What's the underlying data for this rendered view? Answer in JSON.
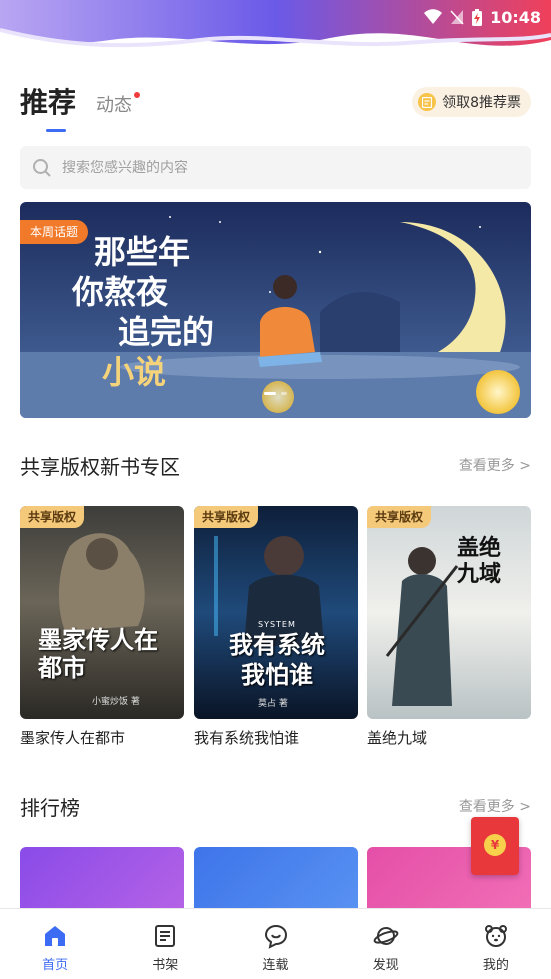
{
  "status_bar": {
    "time": "10:48"
  },
  "header": {
    "tab_recommend": "推荐",
    "tab_dynamic": "动态",
    "ticket_label": "领取8推荐票"
  },
  "search": {
    "placeholder": "搜索您感兴趣的内容"
  },
  "banner": {
    "tag": "本周话题",
    "headline": [
      "那些年",
      "你熬夜",
      "追完的",
      "小说"
    ]
  },
  "shared_section": {
    "title": "共享版权新书专区",
    "more": "查看更多 >",
    "books": [
      {
        "tag": "共享版权",
        "name": "墨家传人在都市",
        "cover_title": "墨家传人在都市",
        "cover_author": "小蜜炒饭 著"
      },
      {
        "tag": "共享版权",
        "name": "我有系统我怕谁",
        "cover_title": "我有系统我怕谁",
        "cover_sub": "SYSTEM",
        "cover_author": "莫占 著"
      },
      {
        "tag": "共享版权",
        "name": "盖绝九域",
        "cover_title": "盖绝九域"
      }
    ]
  },
  "rank_section": {
    "title": "排行榜",
    "more": "查看更多 >"
  },
  "redpack": {
    "coin": "¥"
  },
  "nav": [
    {
      "label": "首页"
    },
    {
      "label": "书架"
    },
    {
      "label": "连载"
    },
    {
      "label": "发现"
    },
    {
      "label": "我的"
    }
  ],
  "colors": {
    "accent": "#3c6cf3",
    "tag_orange": "#f07a2a",
    "badge_red": "#f03c3c"
  }
}
